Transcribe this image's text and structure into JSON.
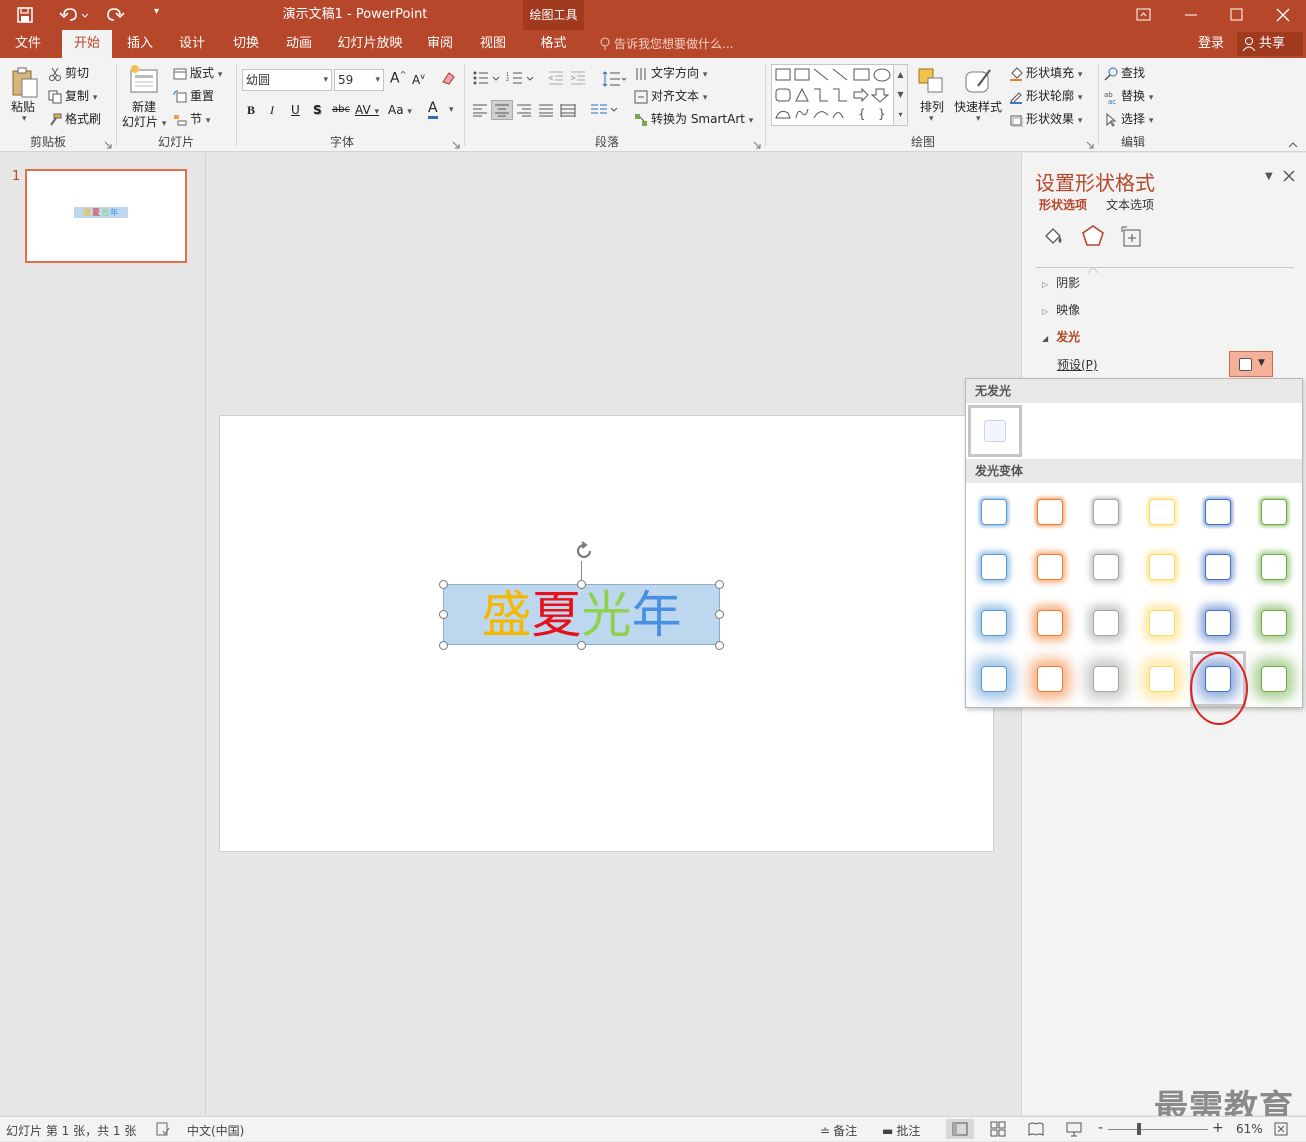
{
  "app": {
    "title": "演示文稿1 - PowerPoint",
    "context_group": "绘图工具"
  },
  "quick_access": {
    "save": "save-icon",
    "undo": "undo-icon",
    "redo": "redo-icon"
  },
  "tabs": [
    "文件",
    "开始",
    "插入",
    "设计",
    "切换",
    "动画",
    "幻灯片放映",
    "审阅",
    "视图",
    "格式"
  ],
  "active_tab": "开始",
  "tell_me": "告诉我您想要做什么...",
  "account": {
    "login": "登录",
    "share": "共享"
  },
  "ribbon": {
    "clipboard": {
      "label": "剪贴板",
      "paste": "粘贴",
      "cut": "剪切",
      "copy": "复制",
      "format_painter": "格式刷"
    },
    "slides": {
      "label": "幻灯片",
      "new_slide_line1": "新建",
      "new_slide_line2": "幻灯片",
      "layout": "版式",
      "reset": "重置",
      "section": "节"
    },
    "font": {
      "label": "字体",
      "font_name": "幼圆",
      "font_size": "59",
      "bold": "B",
      "italic": "I",
      "underline": "U",
      "shadow": "S",
      "strike": "abc",
      "spacing": "AV",
      "case": "Aa",
      "color": "A"
    },
    "paragraph": {
      "label": "段落",
      "text_direction": "文字方向",
      "align_text": "对齐文本",
      "convert_smartart": "转换为 SmartArt"
    },
    "drawing": {
      "label": "绘图",
      "arrange": "排列",
      "quick_styles": "快速样式",
      "shape_fill": "形状填充",
      "shape_outline": "形状轮廓",
      "shape_effects": "形状效果"
    },
    "editing": {
      "label": "编辑",
      "find": "查找",
      "replace": "替换",
      "select": "选择"
    }
  },
  "thumbnail": {
    "number": "1"
  },
  "slide": {
    "text_chars": [
      {
        "char": "盛",
        "color": "#f5b800"
      },
      {
        "char": "夏",
        "color": "#e8101a"
      },
      {
        "char": "光",
        "color": "#8fd14f"
      },
      {
        "char": "年",
        "color": "#4a90e2"
      }
    ],
    "box_fill": "#bdd7ee"
  },
  "format_panel": {
    "title": "设置形状格式",
    "tab_shape": "形状选项",
    "tab_text": "文本选项",
    "sections": [
      "阴影",
      "映像",
      "发光"
    ],
    "expanded": "发光",
    "preset_label": "预设(P)"
  },
  "glow_gallery": {
    "no_glow_header": "无发光",
    "variants_header": "发光变体",
    "colors": [
      "#5b9bd5",
      "#ed7d31",
      "#a5a5a5",
      "#ffd966",
      "#4472c4",
      "#70ad47"
    ],
    "rows": 4,
    "selected": {
      "row": 4,
      "col": 5
    }
  },
  "status_bar": {
    "slide_info": "幻灯片 第 1 张，共 1 张",
    "language": "中文(中国)",
    "notes": "备注",
    "comments": "批注",
    "zoom": "61%"
  },
  "watermark": "最需教育"
}
